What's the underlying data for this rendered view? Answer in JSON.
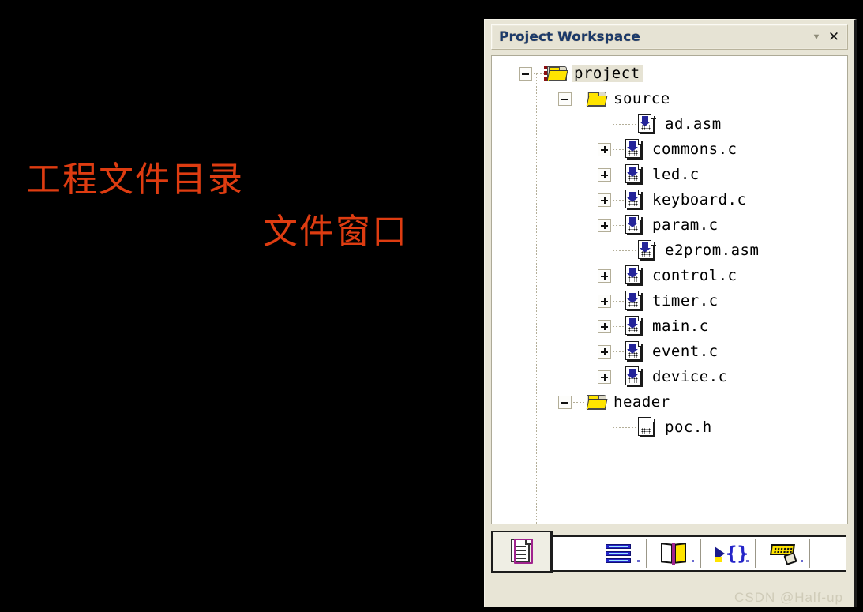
{
  "slide": {
    "annotations": [
      {
        "text": "工程文件目录",
        "color": "#de3c11"
      },
      {
        "text": "文件窗口",
        "color": "#de3c11"
      }
    ],
    "background": "#000000"
  },
  "panel": {
    "title": "Project Workspace",
    "title_color": "#1b3a6b",
    "background": "#e8e5d6",
    "controls": {
      "menu_label": "▼",
      "close_label": "✕"
    }
  },
  "tree": {
    "root": {
      "label": "project",
      "expander": "minus",
      "icon": "folder-project-icon",
      "selected": true
    },
    "groups": [
      {
        "label": "source",
        "expander": "minus",
        "icon": "folder-icon",
        "files": [
          {
            "label": "ad.asm",
            "expander": "none",
            "icon": "source-file-icon"
          },
          {
            "label": "commons.c",
            "expander": "plus",
            "icon": "source-file-icon"
          },
          {
            "label": "led.c",
            "expander": "plus",
            "icon": "source-file-icon"
          },
          {
            "label": "keyboard.c",
            "expander": "plus",
            "icon": "source-file-icon"
          },
          {
            "label": "param.c",
            "expander": "plus",
            "icon": "source-file-icon"
          },
          {
            "label": "e2prom.asm",
            "expander": "none",
            "icon": "source-file-icon"
          },
          {
            "label": "control.c",
            "expander": "plus",
            "icon": "source-file-icon"
          },
          {
            "label": "timer.c",
            "expander": "plus",
            "icon": "source-file-icon"
          },
          {
            "label": "main.c",
            "expander": "plus",
            "icon": "source-file-icon"
          },
          {
            "label": "event.c",
            "expander": "plus",
            "icon": "source-file-icon"
          },
          {
            "label": "device.c",
            "expander": "plus",
            "icon": "source-file-icon"
          }
        ]
      },
      {
        "label": "header",
        "expander": "minus",
        "icon": "folder-icon",
        "files": [
          {
            "label": "poc.h",
            "expander": "none",
            "icon": "header-file-icon"
          }
        ]
      }
    ]
  },
  "tabs": [
    {
      "name": "files",
      "icon": "document-icon",
      "selected": true
    },
    {
      "name": "registers",
      "icon": "registers-icon",
      "selected": false
    },
    {
      "name": "books",
      "icon": "book-icon",
      "selected": false
    },
    {
      "name": "functions",
      "icon": "braces-icon",
      "selected": false
    },
    {
      "name": "templates",
      "icon": "keyboard-icon",
      "selected": false
    }
  ],
  "watermark": "CSDN @Half-up"
}
